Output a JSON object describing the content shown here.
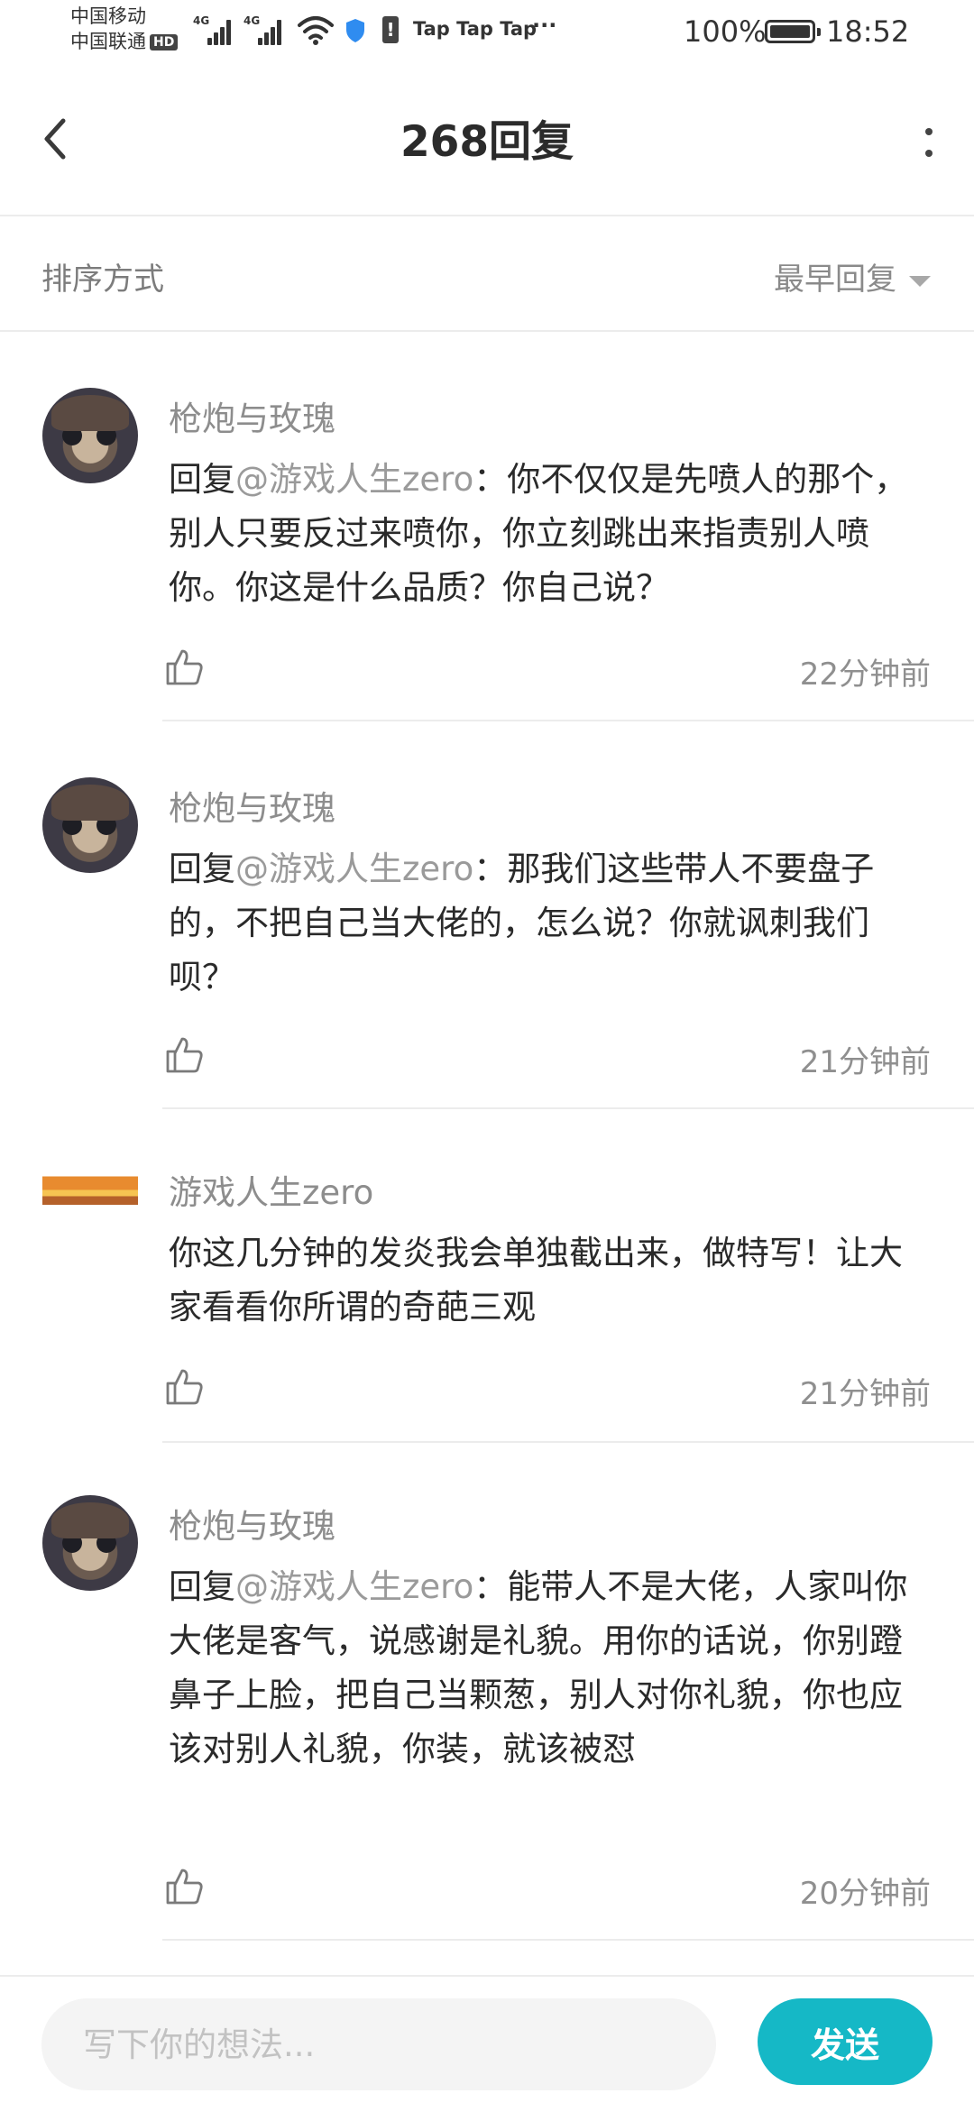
{
  "status_bar": {
    "carrier_1": "中国移动",
    "carrier_2": "中国联通",
    "hd_badge": "HD",
    "network_1": "4G",
    "network_2": "4G",
    "notification_text": "Tap Tap Tap",
    "more_dots": "···",
    "battery_percent": "100%",
    "battery_level": 1.0,
    "time": "18:52",
    "icons": [
      "signal-icon",
      "signal-icon",
      "wifi-icon",
      "shield-icon",
      "alert-icon",
      "battery-icon"
    ]
  },
  "header": {
    "title": "268回复",
    "back_icon": "chevron-left-icon",
    "more_icon": "vertical-dots-icon"
  },
  "sort": {
    "label": "排序方式",
    "selected": "最早回复",
    "caret_icon": "caret-down-icon"
  },
  "comments": [
    {
      "username": "枪炮与玫瑰",
      "reply_prefix": "回复",
      "mention": "@游戏人生zero",
      "separator": "：",
      "text": "你不仅仅是先喷人的那个，别人只要反过来喷你，你立刻跳出来指责别人喷你。你这是什么品质？你自己说？",
      "time": "22分钟前"
    },
    {
      "username": "枪炮与玫瑰",
      "reply_prefix": "回复",
      "mention": "@游戏人生zero",
      "separator": "：",
      "text": "那我们这些带人不要盘子的，不把自己当大佬的，怎么说？你就讽刺我们呗？",
      "time": "21分钟前"
    },
    {
      "username": "游戏人生zero",
      "text": "你这几分钟的发炎我会单独截出来，做特写！让大家看看你所谓的奇葩三观",
      "time": "21分钟前"
    },
    {
      "username": "枪炮与玫瑰",
      "reply_prefix": "回复",
      "mention": "@游戏人生zero",
      "separator": "：",
      "text": "能带人不是大佬，人家叫你大佬是客气，说感谢是礼貌。用你的话说，你别蹬鼻子上脸，把自己当颗葱，别人对你礼貌，你也应该对别人礼貌，你装，就该被怼",
      "time": "20分钟前"
    }
  ],
  "input": {
    "placeholder": "写下你的想法...",
    "value": "",
    "send_label": "发送"
  },
  "colors": {
    "accent": "#15b8c6",
    "muted_text": "#8d8d8d",
    "divider": "#ececec"
  }
}
